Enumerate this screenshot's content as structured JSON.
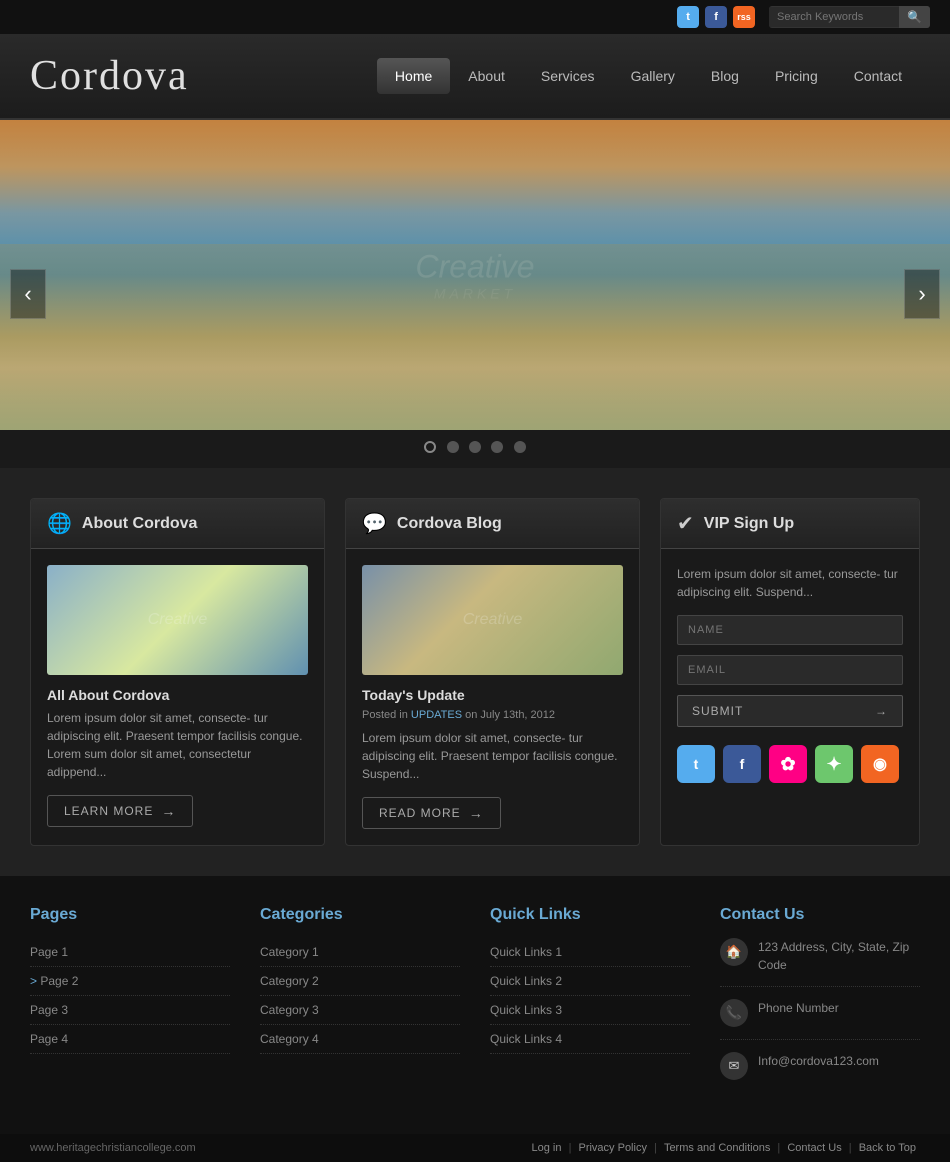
{
  "topbar": {
    "social": [
      {
        "name": "twitter",
        "label": "t",
        "class": "social-twitter"
      },
      {
        "name": "facebook",
        "label": "f",
        "class": "social-facebook"
      },
      {
        "name": "rss",
        "label": "rss",
        "class": "social-rss"
      }
    ],
    "search_placeholder": "Search Keywords"
  },
  "header": {
    "logo": "Cordova",
    "nav": [
      {
        "label": "Home",
        "active": true
      },
      {
        "label": "About",
        "active": false
      },
      {
        "label": "Services",
        "active": false
      },
      {
        "label": "Gallery",
        "active": false
      },
      {
        "label": "Blog",
        "active": false
      },
      {
        "label": "Pricing",
        "active": false
      },
      {
        "label": "Contact",
        "active": false
      }
    ]
  },
  "slider": {
    "dots": 5,
    "active_dot": 0,
    "prev_label": "‹",
    "next_label": "›",
    "watermark": "Creative"
  },
  "about_card": {
    "icon": "🌐",
    "title": "About Cordova",
    "thumb_watermark": "Creative",
    "subtitle": "All About Cordova",
    "text": "Lorem ipsum dolor sit amet, consecte- tur adipiscing elit. Praesent tempor facilisis congue. Lorem sum dolor sit amet, consectetur adippend...",
    "btn_label": "LEARN MORE"
  },
  "blog_card": {
    "icon": "💬",
    "title": "Cordova Blog",
    "thumb_watermark": "Creative",
    "subtitle": "Today's Update",
    "meta_prefix": "Posted in ",
    "meta_tag": "UPDATES",
    "meta_suffix": " on July 13th, 2012",
    "text": "Lorem ipsum dolor sit amet, consecte- tur adipiscing elit. Praesent tempor facilisis congue. Suspend...",
    "btn_label": "READ MORE"
  },
  "vip_card": {
    "icon": "✔",
    "title": "VIP Sign Up",
    "desc": "Lorem ipsum dolor sit amet, consecte- tur adipiscing elit. Suspend...",
    "name_placeholder": "NAME",
    "email_placeholder": "EMAIL",
    "submit_label": "SUBMIT",
    "social": [
      {
        "label": "t",
        "class": "s-tw",
        "name": "twitter"
      },
      {
        "label": "f",
        "class": "s-fb",
        "name": "facebook"
      },
      {
        "label": "✿",
        "class": "s-fl",
        "name": "flickr"
      },
      {
        "label": "✦",
        "class": "s-su",
        "name": "stumbleupon"
      },
      {
        "label": "◉",
        "class": "s-rs",
        "name": "rss"
      }
    ]
  },
  "footer": {
    "pages": {
      "title": "Pages",
      "items": [
        "Page 1",
        "Page 2",
        "Page 3",
        "Page 4"
      ]
    },
    "categories": {
      "title": "Categories",
      "items": [
        "Category 1",
        "Category 2",
        "Category 3",
        "Category 4"
      ]
    },
    "quicklinks": {
      "title": "Quick Links",
      "items": [
        "Quick Links 1",
        "Quick Links 2",
        "Quick Links 3",
        "Quick Links 4"
      ]
    },
    "contact": {
      "title": "Contact Us",
      "address": "123 Address, City, State, Zip Code",
      "phone": "Phone Number",
      "email": "Info@cordova123.com"
    }
  },
  "bottombar": {
    "url": "www.heritagechristiancollege.com",
    "links": [
      "Log in",
      "Privacy Policy",
      "Terms and Conditions",
      "Contact Us",
      "Back to Top"
    ]
  }
}
